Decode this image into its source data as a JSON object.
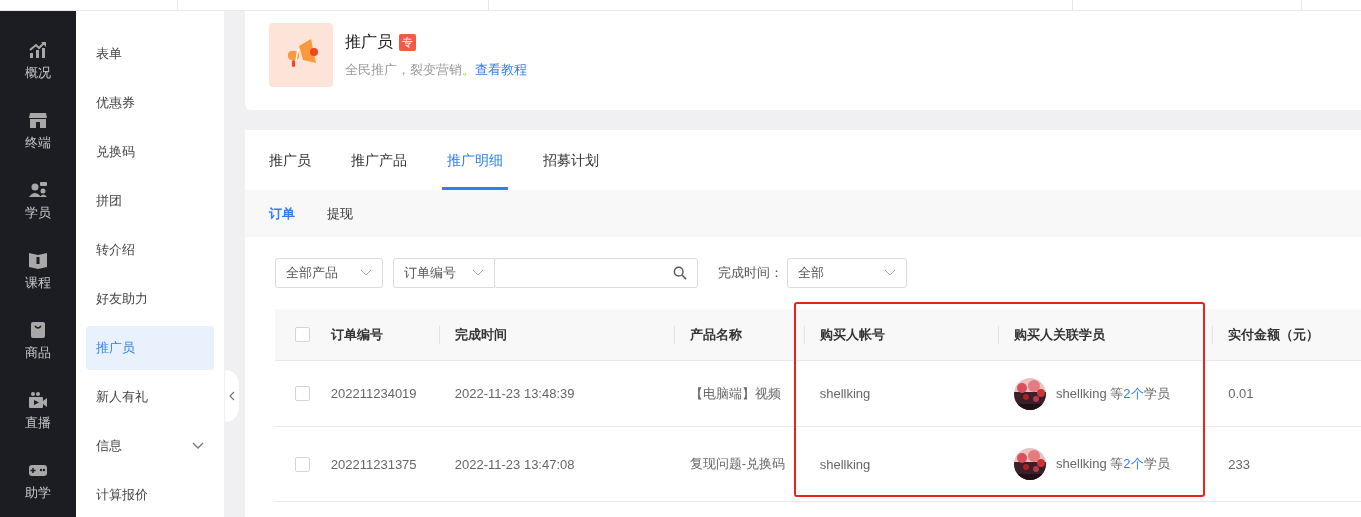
{
  "nav": [
    {
      "label": "概况",
      "selected": false
    },
    {
      "label": "终端",
      "selected": false
    },
    {
      "label": "学员",
      "selected": false
    },
    {
      "label": "课程",
      "selected": false
    },
    {
      "label": "商品",
      "selected": false
    },
    {
      "label": "直播",
      "selected": false
    },
    {
      "label": "助学",
      "selected": false
    }
  ],
  "submenu": [
    {
      "label": "表单",
      "selected": false,
      "kind": "item"
    },
    {
      "label": "优惠券",
      "selected": false,
      "kind": "item"
    },
    {
      "label": "兑换码",
      "selected": false,
      "kind": "item"
    },
    {
      "label": "拼团",
      "selected": false,
      "kind": "item"
    },
    {
      "label": "转介绍",
      "selected": false,
      "kind": "item"
    },
    {
      "label": "好友助力",
      "selected": false,
      "kind": "item"
    },
    {
      "label": "推广员",
      "selected": true,
      "kind": "item"
    },
    {
      "label": "新人有礼",
      "selected": false,
      "kind": "item"
    },
    {
      "label": "信息",
      "selected": false,
      "kind": "group"
    },
    {
      "label": "计算报价",
      "selected": false,
      "kind": "item"
    }
  ],
  "header": {
    "title": "推广员",
    "badge": "专",
    "description": "全民推广，裂变营销。",
    "link": "查看教程"
  },
  "tabs": [
    {
      "label": "推广员",
      "selected": false
    },
    {
      "label": "推广产品",
      "selected": false
    },
    {
      "label": "推广明细",
      "selected": true
    },
    {
      "label": "招募计划",
      "selected": false
    }
  ],
  "subtabs": [
    {
      "label": "订单",
      "selected": true
    },
    {
      "label": "提现",
      "selected": false
    }
  ],
  "filters": {
    "product": "全部产品",
    "field": "订单编号",
    "time_label": "完成时间：",
    "time": "全部"
  },
  "table": {
    "header_checked": false,
    "columns": [
      "订单编号",
      "完成时间",
      "产品名称",
      "购买人帐号",
      "购买人关联学员",
      "实付金额（元）"
    ],
    "rows": [
      {
        "checked": false,
        "order": "202211234019",
        "time": "2022-11-23 13:48:39",
        "product": "【电脑端】视频",
        "account": "shellking",
        "student": "shellking 等",
        "count": "2个",
        "suffix": "学员",
        "amount": "0.01"
      },
      {
        "checked": false,
        "order": "202211231375",
        "time": "2022-11-23 13:47:08",
        "product": "复现问题-兑换码",
        "account": "shellking",
        "student": "shellking 等",
        "count": "2个",
        "suffix": "学员",
        "amount": "233"
      }
    ]
  }
}
